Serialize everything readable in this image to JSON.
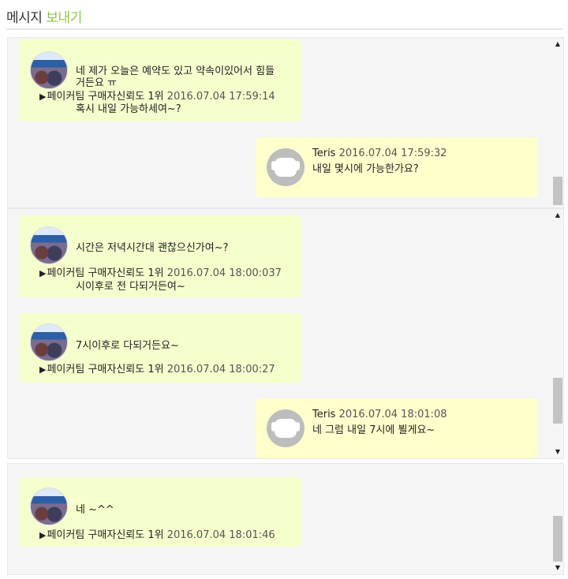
{
  "header": {
    "title_plain": "메시지",
    "title_accent": "보내기"
  },
  "panels": [
    {
      "messages": [
        {
          "side": "left",
          "sender": "페이커팀 구매자신뢰도 1위",
          "timestamp": "2016.07.04 17:59:14",
          "text": "네 제가 오늘은 예약도 있고 약속이있어서 힘들\n거든요 ㅠ",
          "extra": "혹시 내일 가능하세여~?"
        },
        {
          "side": "right",
          "sender": "Teris",
          "timestamp": "2016.07.04 17:59:32",
          "text": "내일 몇시에 가능한가요?"
        }
      ]
    },
    {
      "messages": [
        {
          "side": "left",
          "sender": "페이커팀 구매자신뢰도 1위",
          "timestamp": "2016.07.04 18:00:037",
          "text": "시간은 저녁시간대 괜찮으신가여~?",
          "extra": "시이후로 전 다되거든여~"
        },
        {
          "side": "left",
          "sender": "페이커팀 구매자신뢰도 1위",
          "timestamp": "2016.07.04 18:00:27",
          "text": "7시이후로 다되거든요~"
        },
        {
          "side": "right",
          "sender": "Teris",
          "timestamp": "2016.07.04 18:01:08",
          "text": "네 그럼 내일 7시에 뵐게요~"
        }
      ]
    },
    {
      "messages": [
        {
          "side": "left",
          "sender": "페이커팀 구매자신뢰도 1위",
          "timestamp": "2016.07.04 18:01:46",
          "text": "네 ~^^"
        }
      ]
    }
  ],
  "icons": {
    "scroll_up": "up-arrow-icon",
    "scroll_down": "down-arrow-icon",
    "default_avatar": "default-user-icon"
  },
  "colors": {
    "accent": "#8dc63f",
    "bubble_left": "#f5ffcc",
    "bubble_right": "#ffffcc",
    "panel_bg": "#f5f5f5"
  }
}
